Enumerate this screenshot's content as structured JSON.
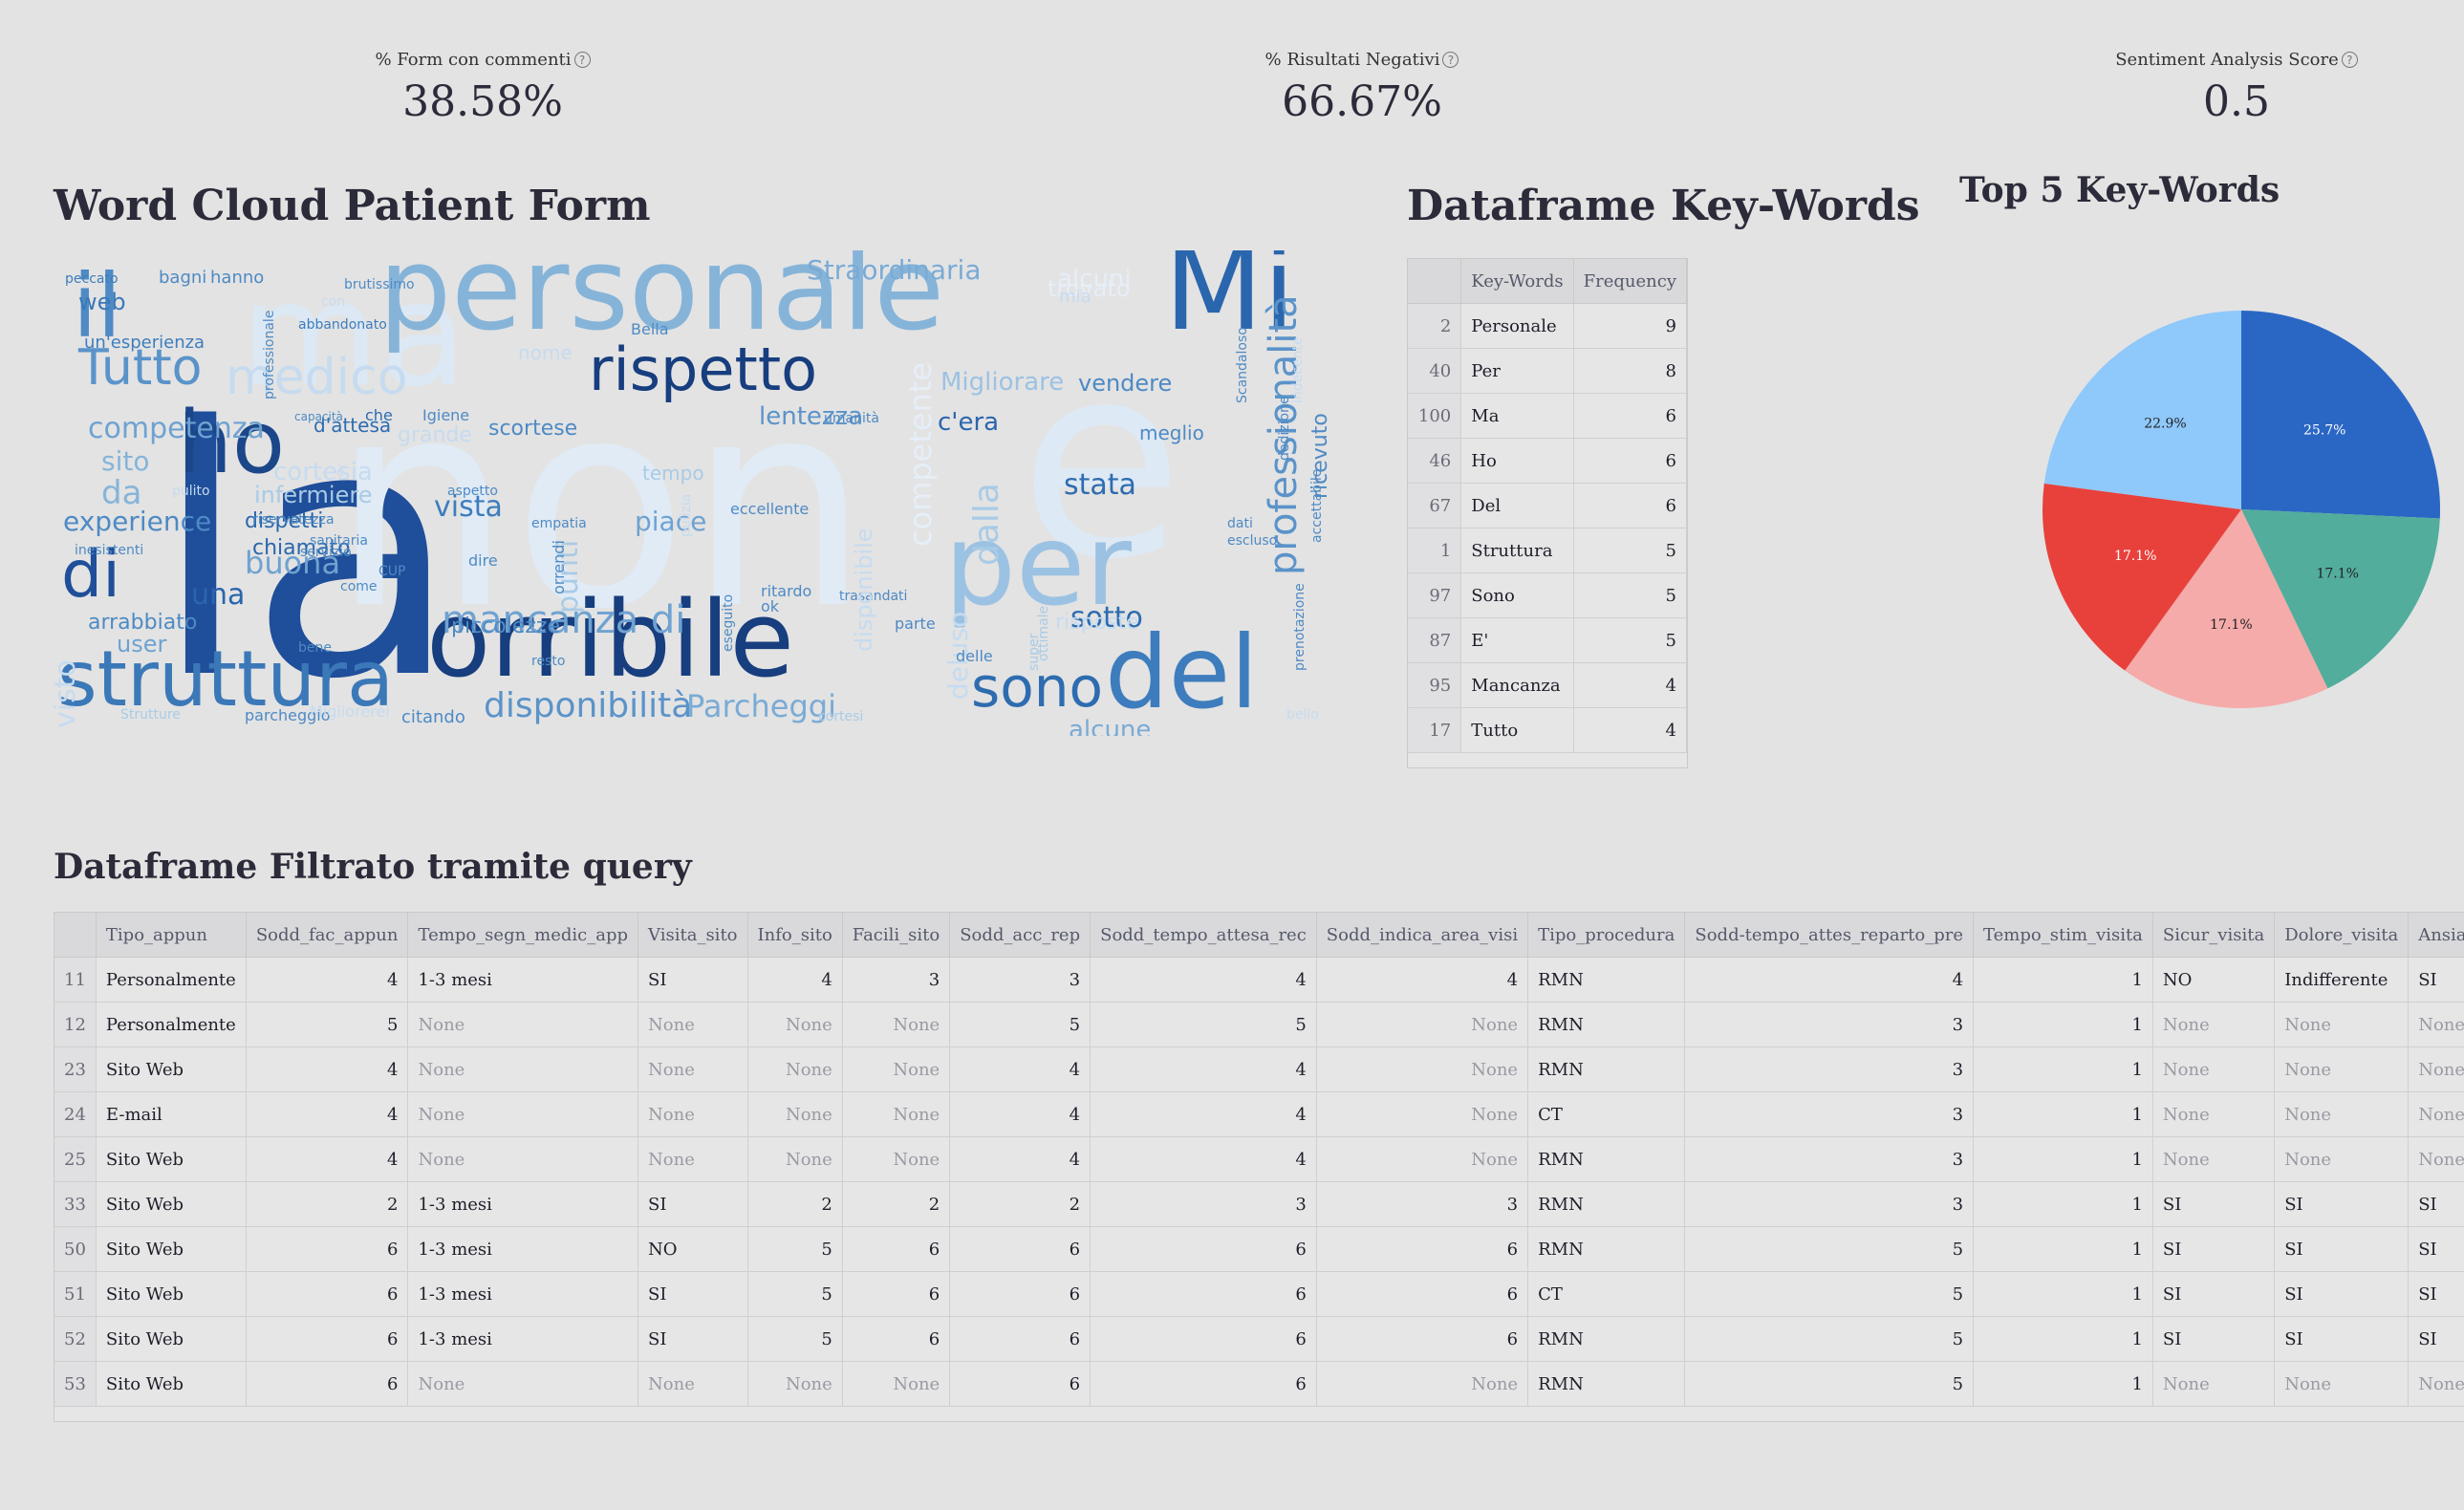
{
  "metrics": [
    {
      "label": "% Form con commenti",
      "value": "38.58%"
    },
    {
      "label": "% Risultati Negativi",
      "value": "66.67%"
    },
    {
      "label": "Sentiment Analysis Score",
      "value": "0.5"
    }
  ],
  "help_glyph": "?",
  "headings": {
    "wordcloud": "Word Cloud Patient Form",
    "keywords_df": "Dataframe Key-Words",
    "top5": "Top 5 Key-Words",
    "filtered": "Dataframe Filtrato tramite query"
  },
  "wordcloud": {
    "words": [
      {
        "t": "la",
        "c": "#1f4e9a"
      },
      {
        "t": "non",
        "c": "#e0ebf6"
      },
      {
        "t": "e",
        "c": "#dde9f5"
      },
      {
        "t": "ma",
        "c": "#dce8f4"
      },
      {
        "t": "personale",
        "c": "#86b4d9"
      },
      {
        "t": "Mi",
        "c": "#2a66ad"
      },
      {
        "t": "il",
        "c": "#4e8ac4"
      },
      {
        "t": "orribile",
        "c": "#173e7e"
      },
      {
        "t": "struttura",
        "c": "#3b78b8"
      },
      {
        "t": "del",
        "c": "#3e7dbd"
      },
      {
        "t": "per",
        "c": "#9cc2e3"
      },
      {
        "t": "rispetto",
        "c": "#173e7e"
      },
      {
        "t": "ho",
        "c": "#1b478a"
      },
      {
        "t": "sono",
        "c": "#2e6cb0"
      },
      {
        "t": "di",
        "c": "#1f4e9a"
      },
      {
        "t": "Tutto",
        "c": "#5a93c9"
      },
      {
        "t": "medico",
        "c": "#c6dbef"
      },
      {
        "t": "mancanza di",
        "c": "#6fa2d1"
      },
      {
        "t": "disponibilità",
        "c": "#5b93c9"
      },
      {
        "t": "Parcheggi",
        "c": "#7aabd5"
      },
      {
        "t": "professionalità",
        "c": "#5b93c9"
      },
      {
        "t": "Straordinaria",
        "c": "#7aabd5"
      },
      {
        "t": "competenza",
        "c": "#6fa2d1"
      },
      {
        "t": "experience",
        "c": "#4e8ac4"
      },
      {
        "t": "buona",
        "c": "#6fa2d1"
      },
      {
        "t": "una",
        "c": "#2a66ad"
      },
      {
        "t": "vista",
        "c": "#3e7dbd"
      },
      {
        "t": "stata",
        "c": "#2e6cb0"
      },
      {
        "t": "sotto",
        "c": "#2e6cb0"
      },
      {
        "t": "piace",
        "c": "#6fa2d1"
      },
      {
        "t": "c'era",
        "c": "#2a66ad"
      },
      {
        "t": "lentezza",
        "c": "#5b93c9"
      },
      {
        "t": "Migliorare",
        "c": "#9cc2e3"
      },
      {
        "t": "vendere",
        "c": "#4e8ac4"
      },
      {
        "t": "alcune",
        "c": "#7aabd5"
      },
      {
        "t": "user",
        "c": "#6fa2d1"
      },
      {
        "t": "arrabbiato",
        "c": "#4e8ac4"
      },
      {
        "t": "sito",
        "c": "#86b4d9"
      },
      {
        "t": "da",
        "c": "#86b4d9"
      },
      {
        "t": "web",
        "c": "#3b78b8"
      },
      {
        "t": "cortesia",
        "c": "#c6dbef"
      },
      {
        "t": "infermiere",
        "c": "#a9cbe6"
      },
      {
        "t": "dispetti",
        "c": "#2a66ad"
      },
      {
        "t": "chiamato",
        "c": "#2a66ad"
      },
      {
        "t": "scortese",
        "c": "#4e8ac4"
      },
      {
        "t": "d'attesa",
        "c": "#2e6cb0"
      },
      {
        "t": "piccolezze",
        "c": "#4e8ac4"
      },
      {
        "t": "competente",
        "c": "#e6eef8"
      },
      {
        "t": "dalla",
        "c": "#a9cbe6"
      },
      {
        "t": "deluso",
        "c": "#c6dbef"
      },
      {
        "t": "punti",
        "c": "#a9cbe6"
      },
      {
        "t": "visto",
        "c": "#c6dbef"
      },
      {
        "t": "tempo",
        "c": "#a9cbe6"
      },
      {
        "t": "alcuni",
        "c": "#e6eef8"
      },
      {
        "t": "trovato",
        "c": "#e6eef8"
      },
      {
        "t": "grande",
        "c": "#c6dbef"
      },
      {
        "t": "risposte",
        "c": "#c6dbef"
      },
      {
        "t": "ricevuto",
        "c": "#4e8ac4"
      },
      {
        "t": "accettabile",
        "c": "#4e8ac4"
      },
      {
        "t": "meglio",
        "c": "#4e8ac4"
      },
      {
        "t": "un'esperienza",
        "c": "#3e7dbd"
      },
      {
        "t": "hanno",
        "c": "#4e8ac4"
      },
      {
        "t": "bagni",
        "c": "#4e8ac4"
      },
      {
        "t": "peccato",
        "c": "#3e7dbd"
      },
      {
        "t": "brutissimo",
        "c": "#4e8ac4"
      },
      {
        "t": "abbandonato",
        "c": "#3e7dbd"
      },
      {
        "t": "nome",
        "c": "#c6dbef"
      },
      {
        "t": "Bella",
        "c": "#4e8ac4"
      },
      {
        "t": "Igiene",
        "c": "#4e8ac4"
      },
      {
        "t": "che",
        "c": "#2e6cb0"
      },
      {
        "t": "capacità",
        "c": "#4e8ac4"
      },
      {
        "t": "riservatezza",
        "c": "#4e8ac4"
      },
      {
        "t": "inesistenti",
        "c": "#4e8ac4"
      },
      {
        "t": "empatia",
        "c": "#4e8ac4"
      },
      {
        "t": "eccellente",
        "c": "#4e8ac4"
      },
      {
        "t": "ritardo",
        "c": "#4e8ac4"
      },
      {
        "t": "ok",
        "c": "#4e8ac4"
      },
      {
        "t": "parte",
        "c": "#4e8ac4"
      },
      {
        "t": "delle",
        "c": "#4e8ac4"
      },
      {
        "t": "resto",
        "c": "#4e8ac4"
      },
      {
        "t": "citando",
        "c": "#4e8ac4"
      },
      {
        "t": "parcheggio",
        "c": "#4e8ac4"
      },
      {
        "t": "Strutture",
        "c": "#a9cbe6"
      },
      {
        "t": "Migliorerei",
        "c": "#c6dbef"
      },
      {
        "t": "cortesi",
        "c": "#a9cbe6"
      },
      {
        "t": "bello",
        "c": "#c6dbef"
      },
      {
        "t": "umanità",
        "c": "#4e8ac4"
      },
      {
        "t": "dire",
        "c": "#4e8ac4"
      },
      {
        "t": "sanitaria",
        "c": "#4e8ac4"
      },
      {
        "t": "servizio",
        "c": "#4e8ac4"
      },
      {
        "t": "come",
        "c": "#4e8ac4"
      },
      {
        "t": "bene",
        "c": "#4e8ac4"
      },
      {
        "t": "pulito",
        "c": "#c6dbef"
      },
      {
        "t": "aspetto",
        "c": "#4e8ac4"
      },
      {
        "t": "dati",
        "c": "#4e8ac4"
      },
      {
        "t": "escluso",
        "c": "#4e8ac4"
      },
      {
        "t": "mia",
        "c": "#c6dbef"
      },
      {
        "t": "con",
        "c": "#c6dbef"
      },
      {
        "t": "Scandaloso",
        "c": "#4e8ac4"
      },
      {
        "t": "indecente",
        "c": "#c6dbef"
      },
      {
        "t": "dedizione",
        "c": "#4e8ac4"
      },
      {
        "t": "prenotazione",
        "c": "#4e8ac4"
      },
      {
        "t": "trasandati",
        "c": "#4e8ac4"
      },
      {
        "t": "ottimale",
        "c": "#a9cbe6"
      },
      {
        "t": "disponibile",
        "c": "#c6dbef"
      },
      {
        "t": "orrendi",
        "c": "#4e8ac4"
      },
      {
        "t": "eseguito",
        "c": "#4e8ac4"
      },
      {
        "t": "pulizia",
        "c": "#c6dbef"
      },
      {
        "t": "super",
        "c": "#a9cbe6"
      },
      {
        "t": "professionale",
        "c": "#4e8ac4"
      },
      {
        "t": "CUP",
        "c": "#4e8ac4"
      },
      {
        "t": "è",
        "c": "#c6dbef"
      }
    ]
  },
  "keywords_table": {
    "headers": [
      "",
      "Key-Words",
      "Frequency"
    ],
    "rows": [
      [
        "2",
        "Personale",
        "9"
      ],
      [
        "40",
        "Per",
        "8"
      ],
      [
        "100",
        "Ma",
        "6"
      ],
      [
        "46",
        "Ho",
        "6"
      ],
      [
        "67",
        "Del",
        "6"
      ],
      [
        "1",
        "Struttura",
        "5"
      ],
      [
        "97",
        "Sono",
        "5"
      ],
      [
        "87",
        "E'",
        "5"
      ],
      [
        "95",
        "Mancanza",
        "4"
      ],
      [
        "17",
        "Tutto",
        "4"
      ]
    ]
  },
  "chart_data": {
    "type": "pie",
    "slices": [
      {
        "label": "25.7%",
        "value": 25.7,
        "color": "#2a67c4"
      },
      {
        "label": "17.1%",
        "value": 17.1,
        "color": "#52ad9c"
      },
      {
        "label": "17.1%",
        "value": 17.1,
        "color": "#f4abaa"
      },
      {
        "label": "17.1%",
        "value": 17.1,
        "color": "#e8413c"
      },
      {
        "label": "22.9%",
        "value": 22.9,
        "color": "#8fc8fb"
      }
    ],
    "start_angle_deg": 0,
    "direction": "clockwise"
  },
  "filtered_table": {
    "headers": [
      "",
      "Tipo_appun",
      "Sodd_fac_appun",
      "Tempo_segn_medic_app",
      "Visita_sito",
      "Info_sito",
      "Facili_sito",
      "Sodd_acc_rep",
      "Sodd_tempo_attesa_rec",
      "Sodd_indica_area_visi",
      "Tipo_procedura",
      "Sodd-tempo_attes_reparto_pre",
      "Tempo_stim_visita",
      "Sicur_visita",
      "Dolore_visita",
      "Ansia_procedura"
    ],
    "numeric_cols": [
      2,
      5,
      6,
      7,
      8,
      9,
      11,
      12
    ],
    "rows": [
      [
        "11",
        "Personalmente",
        "4",
        "1-3 mesi",
        "SI",
        "4",
        "3",
        "3",
        "4",
        "4",
        "RMN",
        "4",
        "1",
        "NO",
        "Indifferente",
        "SI"
      ],
      [
        "12",
        "Personalmente",
        "5",
        "None",
        "None",
        "None",
        "None",
        "5",
        "5",
        "None",
        "RMN",
        "3",
        "1",
        "None",
        "None",
        "None"
      ],
      [
        "23",
        "Sito Web",
        "4",
        "None",
        "None",
        "None",
        "None",
        "4",
        "4",
        "None",
        "RMN",
        "3",
        "1",
        "None",
        "None",
        "None"
      ],
      [
        "24",
        "E-mail",
        "4",
        "None",
        "None",
        "None",
        "None",
        "4",
        "4",
        "None",
        "CT",
        "3",
        "1",
        "None",
        "None",
        "None"
      ],
      [
        "25",
        "Sito Web",
        "4",
        "None",
        "None",
        "None",
        "None",
        "4",
        "4",
        "None",
        "RMN",
        "3",
        "1",
        "None",
        "None",
        "None"
      ],
      [
        "33",
        "Sito Web",
        "2",
        "1-3 mesi",
        "SI",
        "2",
        "2",
        "2",
        "3",
        "3",
        "RMN",
        "3",
        "1",
        "SI",
        "SI",
        "SI"
      ],
      [
        "50",
        "Sito Web",
        "6",
        "1-3 mesi",
        "NO",
        "5",
        "6",
        "6",
        "6",
        "6",
        "RMN",
        "5",
        "1",
        "SI",
        "SI",
        "SI"
      ],
      [
        "51",
        "Sito Web",
        "6",
        "1-3 mesi",
        "SI",
        "5",
        "6",
        "6",
        "6",
        "6",
        "CT",
        "5",
        "1",
        "SI",
        "SI",
        "SI"
      ],
      [
        "52",
        "Sito Web",
        "6",
        "1-3 mesi",
        "SI",
        "5",
        "6",
        "6",
        "6",
        "6",
        "RMN",
        "5",
        "1",
        "SI",
        "SI",
        "SI"
      ],
      [
        "53",
        "Sito Web",
        "6",
        "None",
        "None",
        "None",
        "None",
        "6",
        "6",
        "None",
        "RMN",
        "5",
        "1",
        "None",
        "None",
        "None"
      ]
    ]
  }
}
